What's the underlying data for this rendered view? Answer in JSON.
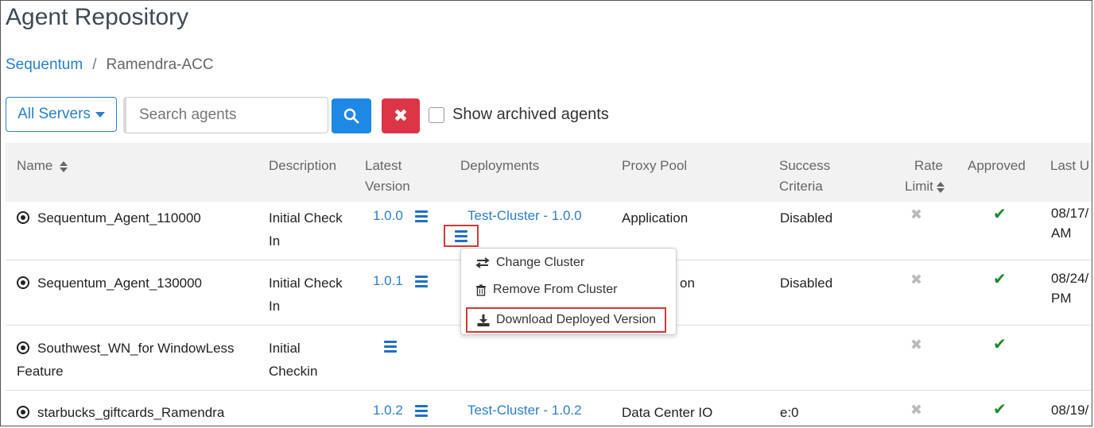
{
  "page": {
    "title": "Agent Repository"
  },
  "breadcrumb": {
    "root": "Sequentum",
    "separator": "/",
    "current": "Ramendra-ACC"
  },
  "toolbar": {
    "servers_label": "All Servers",
    "search_placeholder": "Search agents",
    "search_value": "",
    "clear_label": "✖",
    "archived_label": "Show archived agents",
    "archived_checked": false
  },
  "table": {
    "columns": {
      "name": "Name",
      "description": "Description",
      "latest_version_1": "Latest",
      "latest_version_2": "Version",
      "deployments": "Deployments",
      "proxy_pool": "Proxy Pool",
      "success_1": "Success",
      "success_2": "Criteria",
      "rate_1": "Rate",
      "rate_2": "Limit",
      "approved": "Approved",
      "last": "Last U"
    },
    "rows": [
      {
        "name": "Sequentum_Agent_110000",
        "name2": "",
        "desc1": "Initial Check",
        "desc2": "In",
        "version": "1.0.0",
        "deployment": "Test-Cluster - 1.0.0",
        "proxy": "Application",
        "success": "Disabled",
        "rate": "✖",
        "approved": "✔",
        "last1": "08/17/",
        "last2": "AM"
      },
      {
        "name": "Sequentum_Agent_130000",
        "name2": "",
        "desc1": "Initial Check",
        "desc2": "In",
        "version": "1.0.1",
        "deployment": "",
        "proxy": "on",
        "success": "Disabled",
        "rate": "✖",
        "approved": "✔",
        "last1": "08/24/",
        "last2": "PM"
      },
      {
        "name": "Southwest_WN_for WindowLess",
        "name2": "Feature",
        "desc1": "Initial",
        "desc2": "Checkin",
        "version": "",
        "deployment": "",
        "proxy": "",
        "success": "",
        "rate": "✖",
        "approved": "✔",
        "last1": "",
        "last2": ""
      },
      {
        "name": "starbucks_giftcards_Ramendra",
        "name2": "",
        "desc1": "",
        "desc2": "",
        "version": "1.0.2",
        "deployment": "Test-Cluster - 1.0.2",
        "proxy": "Data Center IO",
        "success": "e:0",
        "rate": "✖",
        "approved": "✔",
        "last1": "08/19/",
        "last2": ""
      }
    ]
  },
  "context_menu": {
    "change_cluster": "Change Cluster",
    "remove_from_cluster": "Remove From Cluster",
    "download_deployed_version": "Download Deployed Version"
  },
  "colors": {
    "primary": "#1e88e5",
    "danger": "#dc3545",
    "link": "#2a7fc9",
    "approved": "#1d8a2e",
    "highlight": "#d03a3a"
  }
}
